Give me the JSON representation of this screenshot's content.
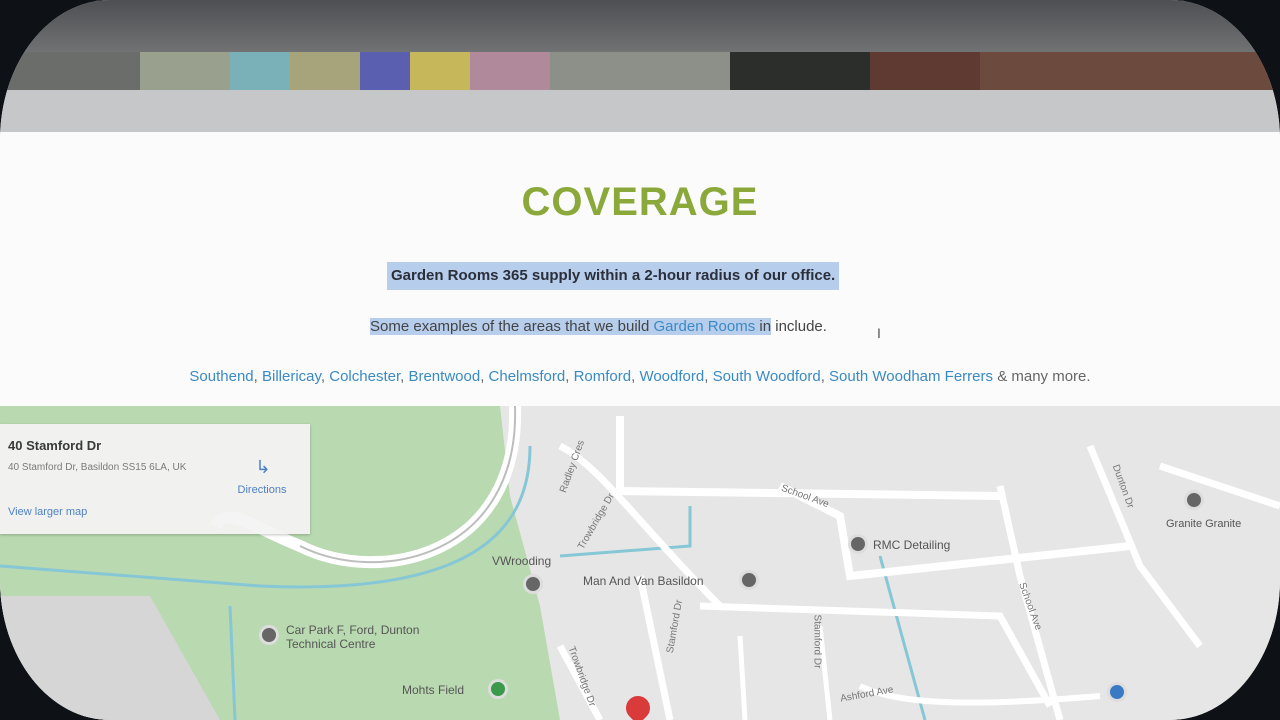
{
  "coverage": {
    "title": "COVERAGE",
    "intro": "Garden Rooms 365 supply within a 2-hour radius of our office.",
    "examples_prefix": "Some examples of the areas that we build ",
    "examples_link": "Garden Rooms",
    "examples_middle": " in",
    "examples_suffix": " include.",
    "areas": [
      "Southend",
      "Billericay",
      "Colchester",
      "Brentwood",
      "Chelmsford",
      "Romford",
      "Woodford",
      "South Woodford",
      "South Woodham Ferrers"
    ],
    "areas_suffix": "& many more."
  },
  "map": {
    "place_title": "40 Stamford Dr",
    "place_address": "40 Stamford Dr, Basildon SS15 6LA, UK",
    "directions_label": "Directions",
    "larger_map_label": "View larger map",
    "pois": [
      "RMC Detailing",
      "Man And Van Basildon",
      "VWrooding",
      "Car Park F, Ford, Dunton Technical Centre",
      "Mohts Field",
      "Granite Granite"
    ],
    "streets": [
      "Radley Cres",
      "Trowbridge Dr",
      "School Ave",
      "Stamford Dr",
      "Dunton Dr",
      "Ashford Ave",
      "School Ave",
      "Trowbridge Dr",
      "Stamford Dr"
    ],
    "colors": {
      "park": "#b9d9b0",
      "road": "#ffffff",
      "water": "#86c7d6",
      "pin": "#d93a3a"
    }
  },
  "colors": {
    "title": "#8aa93a",
    "link": "#3a8ac4",
    "highlight": "#b7cdec"
  }
}
